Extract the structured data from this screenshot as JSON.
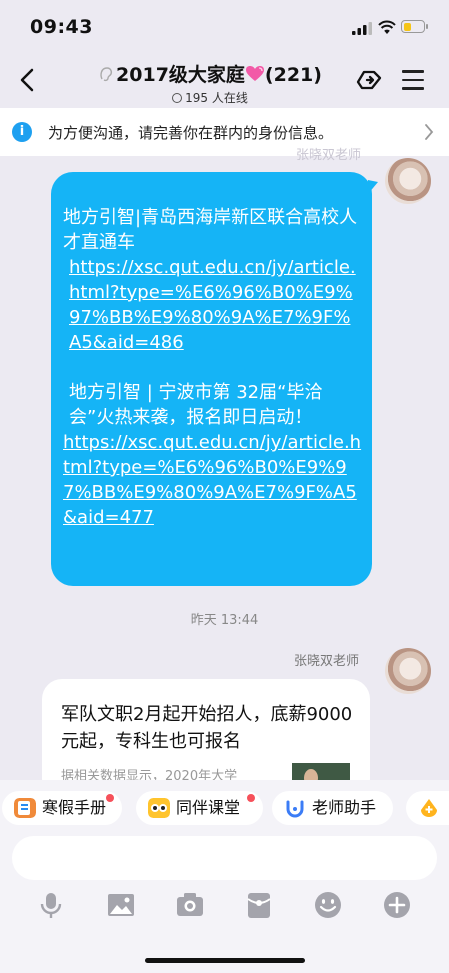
{
  "status": {
    "time": "09:43"
  },
  "header": {
    "title": "2017级大家庭",
    "count": "(221)",
    "online": "195 人在线"
  },
  "notice": {
    "text": "为方便沟通，请完善你在群内的身份信息。"
  },
  "messages": {
    "first_sender": "张晓双老师",
    "line1": "地方引智|青岛西海岸新区联合高校人才直通车",
    "link1": "https://xsc.qut.edu.cn/jy/article.html?type=%E6%96%B0%E9%97%BB%E9%80%9A%E7%9F%A5&aid=486",
    "line2": "地方引智 | 宁波市第 32届“毕洽会”火热来袭，报名即日启动！",
    "link2": "https://xsc.qut.edu.cn/jy/article.html?type=%E6%96%B0%E9%97%BB%E9%80%9A%E7%9F%A5&aid=477",
    "timestamp": "昨天 13:44",
    "second_sender": "张晓双老师",
    "card_title": "军队文职2月起开始招人，底薪9000元起，专科生也可报名",
    "card_summary": "据相关数据显示，2020年大学"
  },
  "shortcuts": [
    {
      "label": "寒假手册",
      "icon": "handbook-icon",
      "badge": true
    },
    {
      "label": "同伴课堂",
      "icon": "classroom-icon",
      "badge": true
    },
    {
      "label": "老师助手",
      "icon": "assistant-icon",
      "badge": false
    },
    {
      "label": "",
      "icon": "more-app-icon",
      "badge": false
    }
  ],
  "input": {
    "placeholder": ""
  },
  "colors": {
    "bubble": "#15b4f6",
    "info": "#1ea0f0",
    "badge": "#f6505a"
  }
}
